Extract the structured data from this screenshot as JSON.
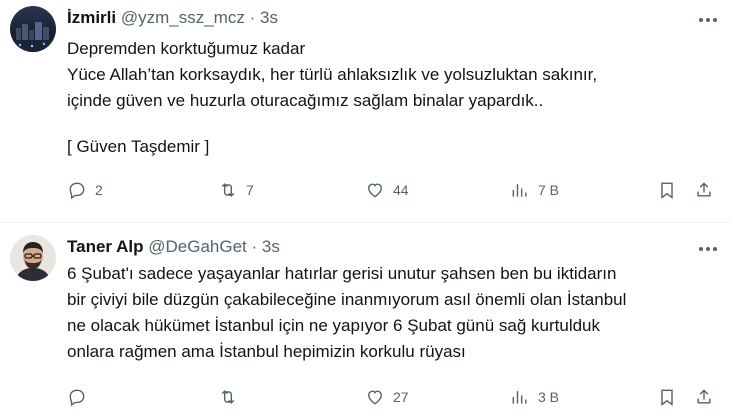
{
  "tweets": [
    {
      "name": "İzmirli",
      "handle": "@yzm_ssz_mcz",
      "separator": "·",
      "time": "3s",
      "lines": [
        "Depremden korktuğumuz kadar",
        "Yüce Allah’tan korksaydık, her türlü ahlaksızlık ve yolsuzluktan sakınır,",
        "içinde güven ve huzurla oturacağımız sağlam binalar yapardık..",
        "",
        "[ Güven Taşdemir ]"
      ],
      "replies": "2",
      "reposts": "7",
      "likes": "44",
      "views": "7 B"
    },
    {
      "name": "Taner Alp",
      "handle": "@DeGahGet",
      "separator": "·",
      "time": "3s",
      "lines": [
        "6 Şubat'ı sadece yaşayanlar hatırlar gerisi unutur şahsen ben bu iktidarın",
        "bir çiviyi bile düzgün çakabileceğine inanmıyorum asıl önemli olan İstanbul",
        "ne olacak hükümet İstanbul için ne yapıyor 6 Şubat günü sağ kurtulduk",
        "onlara rağmen ama İstanbul hepimizin korkulu rüyası"
      ],
      "replies": "",
      "reposts": "",
      "likes": "27",
      "views": "3 B"
    }
  ],
  "colors": {
    "text": "#0f1419",
    "secondary": "#536471",
    "divider": "#eff3f4"
  },
  "icons": [
    "reply-icon",
    "repost-icon",
    "like-icon",
    "views-icon",
    "bookmark-icon",
    "share-icon",
    "more-icon"
  ]
}
